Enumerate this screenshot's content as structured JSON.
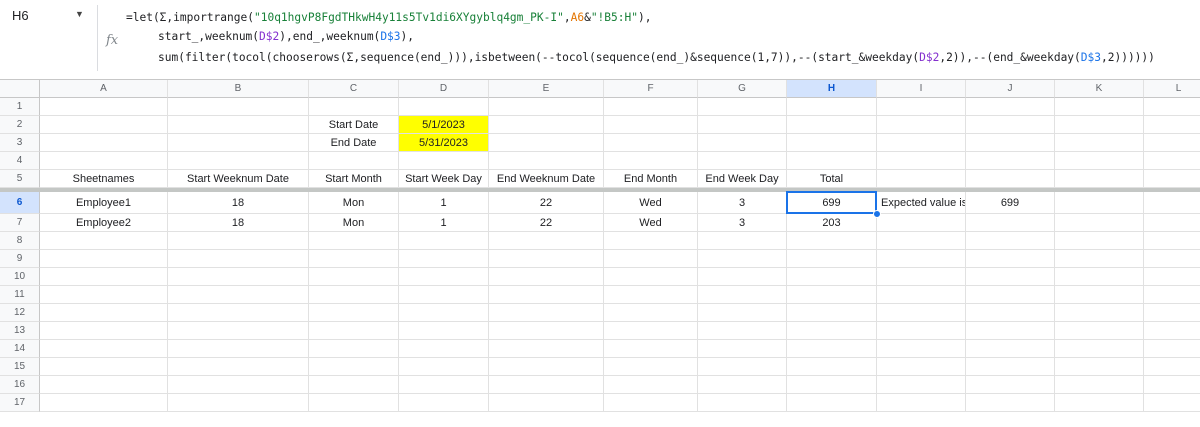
{
  "formula_bar": {
    "cell_ref": "H6",
    "fx_label": "fx",
    "line1": {
      "a": "=let(Σ,importrange(",
      "s": "\"10q1hgvP8FgdTHkwH4y11s5Tv1di6XYgyblq4gm_PK-I\"",
      "b": ",",
      "r1": "A6",
      "c": "&",
      "s2": "\"!B5:H\"",
      "d": "),"
    },
    "line2": {
      "a": "start_,weeknum(",
      "r1": "D$2",
      "b": "),end_,weeknum(",
      "r2": "D$3",
      "c": "),"
    },
    "line3": {
      "a": "sum(filter(tocol(chooserows(Σ,sequence(end_))),isbetween(--tocol(sequence(end_)&sequence(1,7)),--(start_&weekday(",
      "r1": "D$2",
      "b": ",2)),--(end_&weekday(",
      "r2": "D$3",
      "c": ",2))))))"
    }
  },
  "columns": [
    "A",
    "B",
    "C",
    "D",
    "E",
    "F",
    "G",
    "H",
    "I",
    "J",
    "K",
    "L"
  ],
  "rows": [
    "1",
    "2",
    "3",
    "4",
    "5",
    "6",
    "7",
    "8",
    "9",
    "10",
    "11",
    "12",
    "13",
    "14",
    "15",
    "16",
    "17"
  ],
  "selected_cell": "H6",
  "cells": {
    "C2": "Start Date",
    "D2": "5/1/2023",
    "C3": "End Date",
    "D3": "5/31/2023",
    "A5": "Sheetnames",
    "B5": "Start Weeknum Date",
    "C5": "Start Month",
    "D5": "Start Week Day",
    "E5": "End Weeknum Date",
    "F5": "End Month",
    "G5": "End Week Day",
    "H5": "Total",
    "A6": "Employee1",
    "B6": "18",
    "C6": "Mon",
    "D6": "1",
    "E6": "22",
    "F6": "Wed",
    "G6": "3",
    "H6": "699",
    "I6": "Expected value is",
    "J6": "699",
    "A7": "Employee2",
    "B7": "18",
    "C7": "Mon",
    "D7": "1",
    "E7": "22",
    "F7": "Wed",
    "G7": "3",
    "H7": "203"
  },
  "highlight_color": "#ffff00",
  "selection_color": "#1a73e8"
}
